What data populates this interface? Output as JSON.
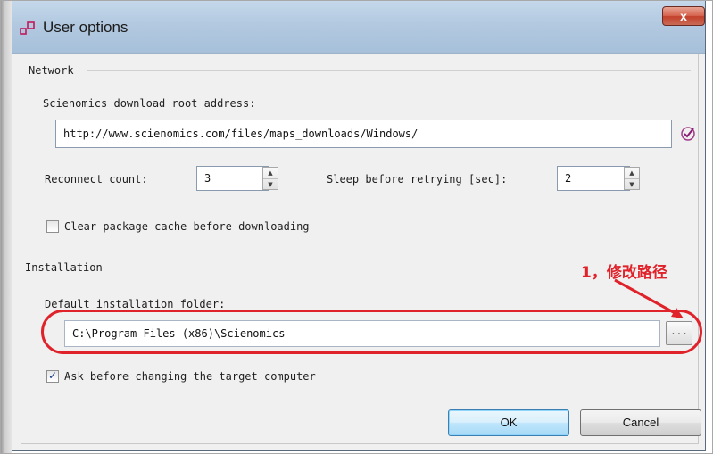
{
  "window": {
    "title": "User options",
    "close_label": "x"
  },
  "network": {
    "group_label": "Network",
    "root_address_label": "Scienomics download root address:",
    "root_address_value": "http://www.scienomics.com/files/maps_downloads/Windows/",
    "reconnect_label": "Reconnect count:",
    "reconnect_value": "3",
    "sleep_label": "Sleep before retrying [sec]:",
    "sleep_value": "2",
    "clear_cache_label": "Clear package cache before downloading",
    "clear_cache_checked": false
  },
  "installation": {
    "group_label": "Installation",
    "folder_label": "Default installation folder:",
    "folder_value": "C:\\Program Files (x86)\\Scienomics",
    "browse_label": "...",
    "ask_label": "Ask before changing the target computer",
    "ask_checked": true
  },
  "buttons": {
    "ok_label": "OK",
    "cancel_label": "Cancel"
  },
  "annotation": {
    "text": "1，修改路径",
    "color": "#e0222a"
  },
  "icons": {
    "app": "app-window-icon",
    "validate": "checkmark-circle-icon",
    "spin_up": "chevron-up-icon",
    "spin_down": "chevron-down-icon"
  }
}
